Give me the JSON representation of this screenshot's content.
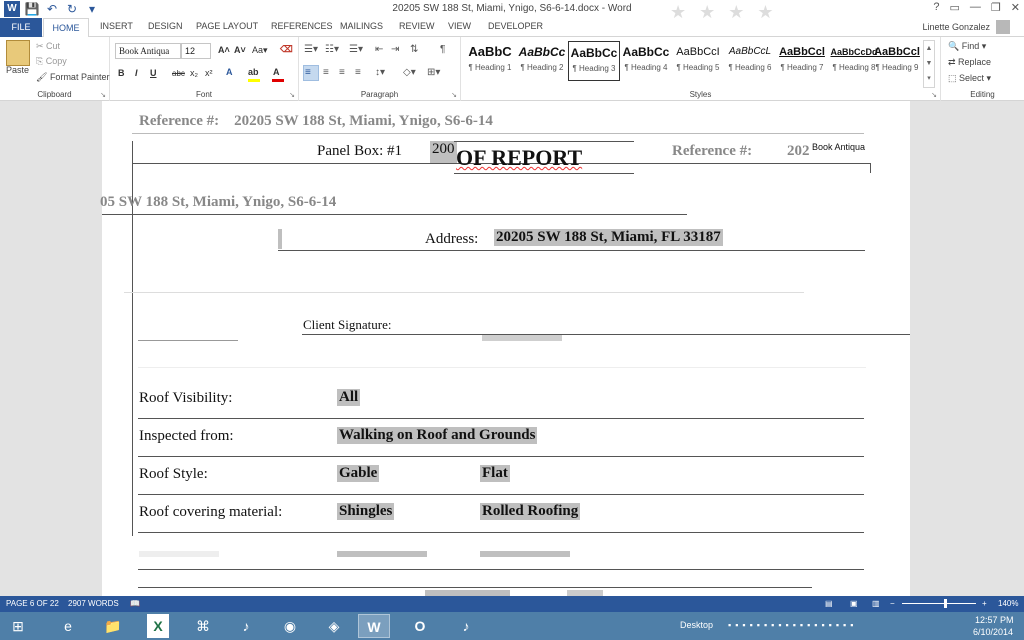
{
  "window": {
    "title": "20205 SW 188 St, Miami, Ynigo, S6-6-14.docx - Word",
    "controls": [
      "?",
      "▭",
      "—",
      "❐",
      "✕"
    ]
  },
  "tabs": {
    "file": "FILE",
    "items": [
      "HOME",
      "INSERT",
      "DESIGN",
      "PAGE LAYOUT",
      "REFERENCES",
      "MAILINGS",
      "REVIEW",
      "VIEW",
      "DEVELOPER"
    ],
    "user": "Linette Gonzalez"
  },
  "ribbon": {
    "clipboard": {
      "paste": "Paste",
      "cut": "Cut",
      "copy": "Copy",
      "format_painter": "Format Painter",
      "label": "Clipboard"
    },
    "font": {
      "font_name": "Book Antiqua",
      "font_size": "12",
      "label": "Font",
      "buttons": [
        "B",
        "I",
        "U",
        "abc",
        "x₂",
        "x²"
      ]
    },
    "paragraph": {
      "label": "Paragraph"
    },
    "styles": {
      "label": "Styles",
      "items": [
        {
          "sample": "AaBbC",
          "label": "¶ Heading 1"
        },
        {
          "sample": "AaBbCc",
          "label": "¶ Heading 2"
        },
        {
          "sample": "AaBbCc",
          "label": "¶ Heading 3"
        },
        {
          "sample": "AaBbCc",
          "label": "¶ Heading 4"
        },
        {
          "sample": "AaBbCcI",
          "label": "¶ Heading 5"
        },
        {
          "sample": "AaBbCcL",
          "label": "¶ Heading 6"
        },
        {
          "sample": "AaBbCcl",
          "label": "¶ Heading 7"
        },
        {
          "sample": "AaBbCcDd",
          "label": "¶ Heading 8"
        },
        {
          "sample": "AaBbCcl",
          "label": "¶ Heading 9"
        }
      ]
    },
    "editing": {
      "find": "Find",
      "replace": "Replace",
      "select": "Select",
      "label": "Editing"
    }
  },
  "document": {
    "header_ref_label": "Reference #:",
    "header_ref_value": "20205 SW 188 St, Miami, Ynigo, S6-6-14",
    "panel_box_label": "Panel Box: #1",
    "panel_box_value": "200",
    "report_title": "OF  REPORT",
    "ref2_label": "Reference #:",
    "ref2_value": "202",
    "font_tip": "Book Antiqua",
    "ref_line": "05 SW 188 St, Miami, Ynigo, S6-6-14",
    "address_label": "Address:",
    "address_value": "20205 SW 188 St, Miami, FL 33187",
    "client_signature": "Client Signature:",
    "rows": [
      {
        "label": "Roof Visibility:",
        "v1": "All",
        "v2": ""
      },
      {
        "label": "Inspected from:",
        "v1": "Walking on Roof and Grounds",
        "v2": ""
      },
      {
        "label": "Roof Style:",
        "v1": "Gable",
        "v2": "Flat"
      },
      {
        "label": "Roof covering material:",
        "v1": "Shingles",
        "v2": "Rolled Roofing"
      }
    ]
  },
  "status": {
    "page": "PAGE 6 OF 22",
    "words": "2907 WORDS",
    "zoom": "140%"
  },
  "taskbar": {
    "desktop": "Desktop",
    "time": "12:57 PM",
    "date": "6/10/2014"
  }
}
